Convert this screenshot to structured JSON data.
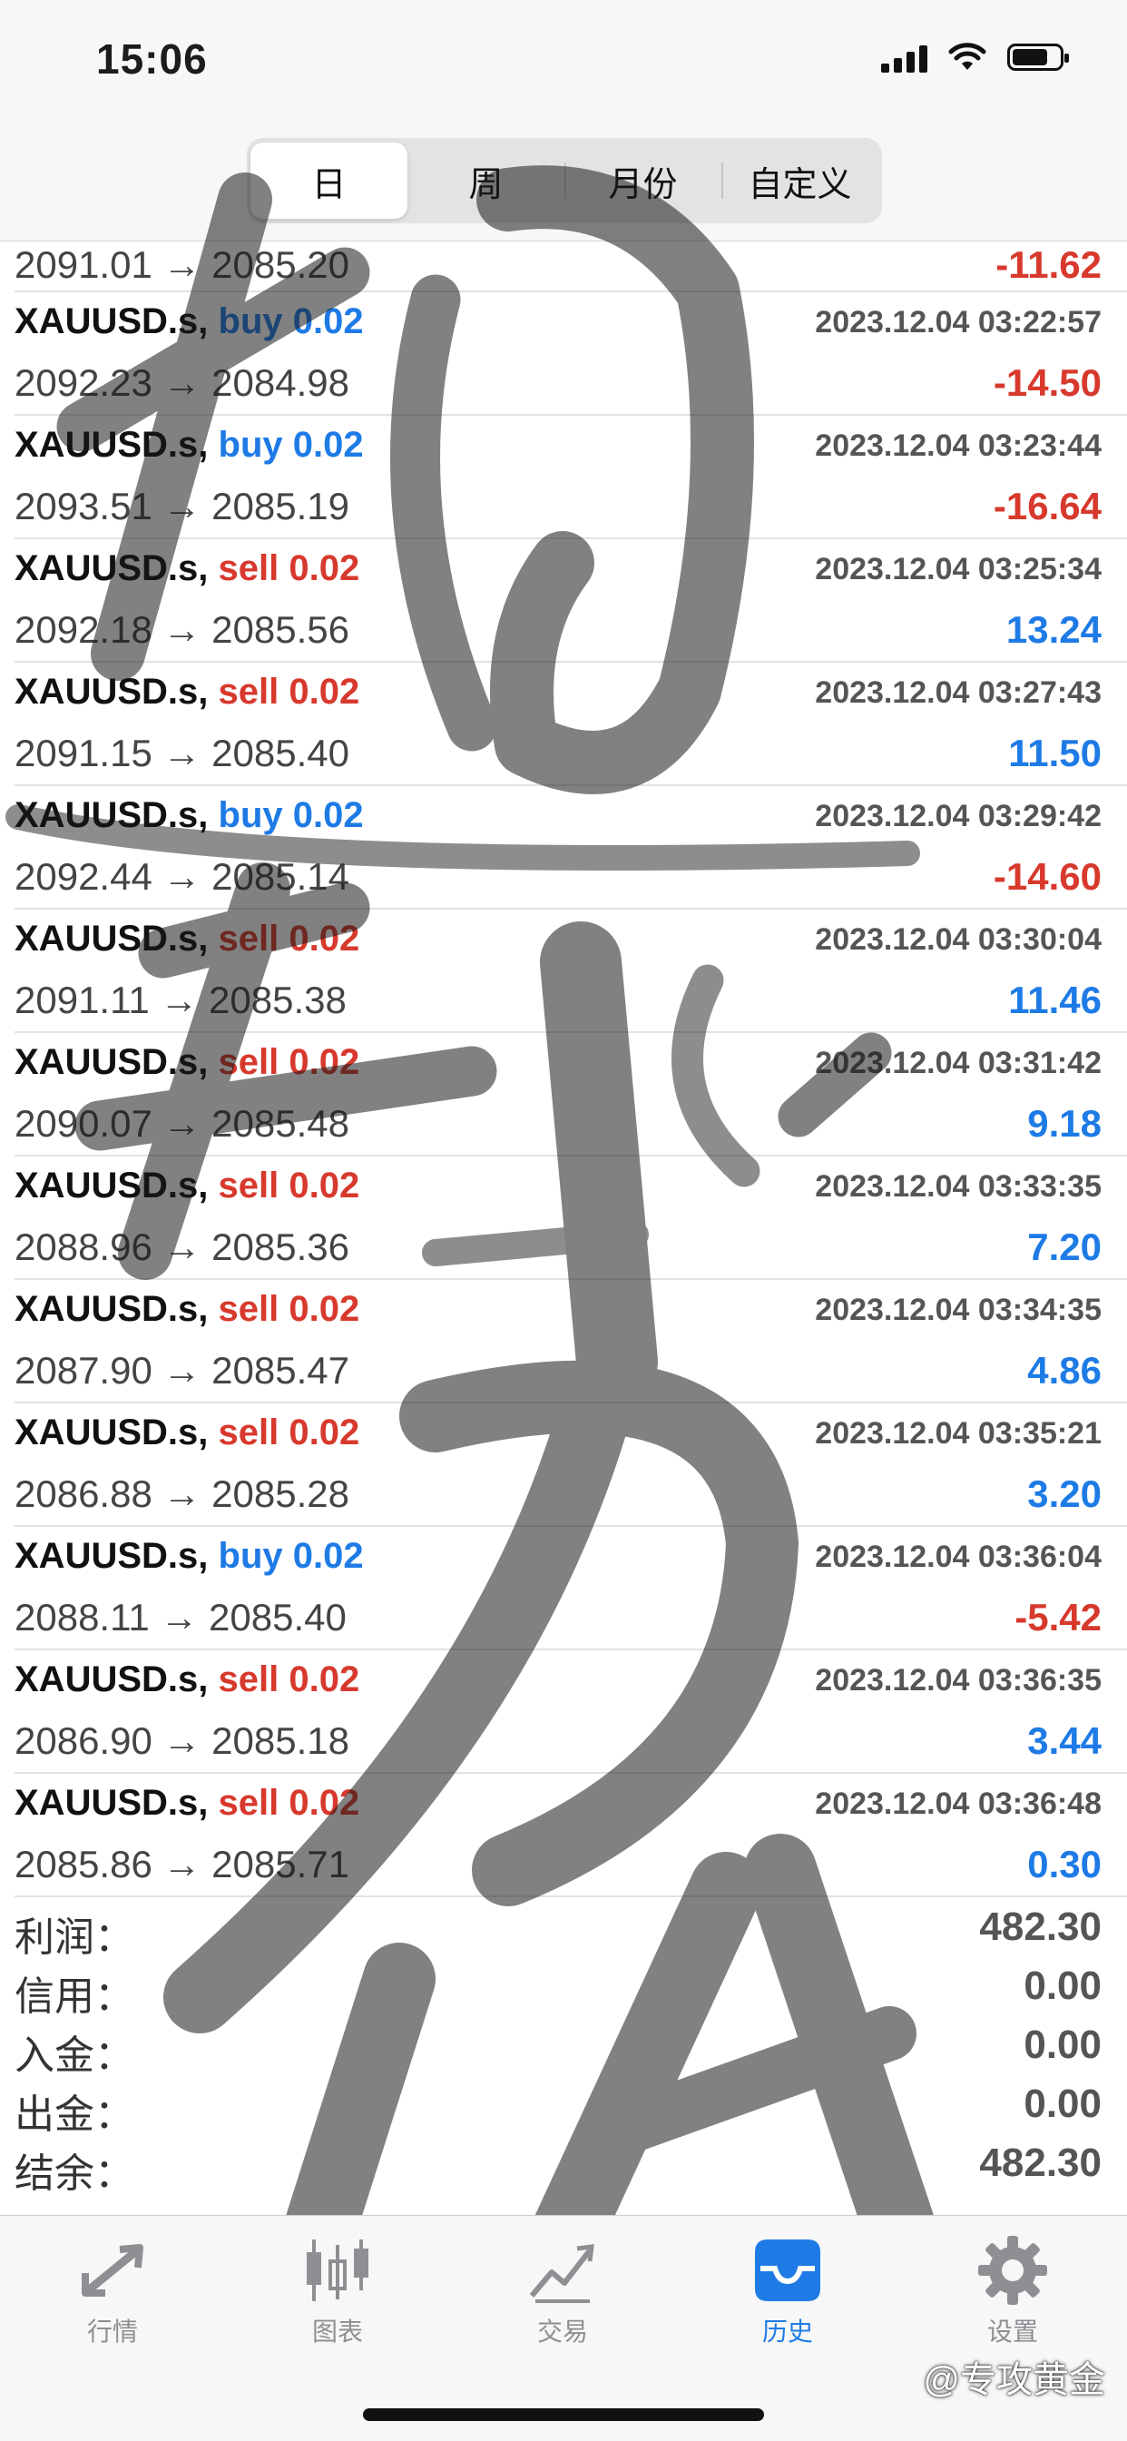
{
  "status_bar": {
    "time": "15:06"
  },
  "period_tabs": [
    {
      "label": "日",
      "active": true
    },
    {
      "label": "周",
      "active": false
    },
    {
      "label": "月份",
      "active": false
    },
    {
      "label": "自定义",
      "active": false
    }
  ],
  "first_row": {
    "prices": "2091.01 → 2085.20",
    "profit": "-11.62"
  },
  "trades": [
    {
      "symbol": "XAUUSD.s,",
      "side": "buy 0.02",
      "time": "2023.12.04 03:22:57",
      "prices": "2092.23 → 2084.98",
      "profit": "-14.50"
    },
    {
      "symbol": "XAUUSD.s,",
      "side": "buy 0.02",
      "time": "2023.12.04 03:23:44",
      "prices": "2093.51 → 2085.19",
      "profit": "-16.64"
    },
    {
      "symbol": "XAUUSD.s,",
      "side": "sell 0.02",
      "time": "2023.12.04 03:25:34",
      "prices": "2092.18 → 2085.56",
      "profit": "13.24"
    },
    {
      "symbol": "XAUUSD.s,",
      "side": "sell 0.02",
      "time": "2023.12.04 03:27:43",
      "prices": "2091.15 → 2085.40",
      "profit": "11.50"
    },
    {
      "symbol": "XAUUSD.s,",
      "side": "buy 0.02",
      "time": "2023.12.04 03:29:42",
      "prices": "2092.44 → 2085.14",
      "profit": "-14.60"
    },
    {
      "symbol": "XAUUSD.s,",
      "side": "sell 0.02",
      "time": "2023.12.04 03:30:04",
      "prices": "2091.11 → 2085.38",
      "profit": "11.46"
    },
    {
      "symbol": "XAUUSD.s,",
      "side": "sell 0.02",
      "time": "2023.12.04 03:31:42",
      "prices": "2090.07 → 2085.48",
      "profit": "9.18"
    },
    {
      "symbol": "XAUUSD.s,",
      "side": "sell 0.02",
      "time": "2023.12.04 03:33:35",
      "prices": "2088.96 → 2085.36",
      "profit": "7.20"
    },
    {
      "symbol": "XAUUSD.s,",
      "side": "sell 0.02",
      "time": "2023.12.04 03:34:35",
      "prices": "2087.90 → 2085.47",
      "profit": "4.86"
    },
    {
      "symbol": "XAUUSD.s,",
      "side": "sell 0.02",
      "time": "2023.12.04 03:35:21",
      "prices": "2086.88 → 2085.28",
      "profit": "3.20"
    },
    {
      "symbol": "XAUUSD.s,",
      "side": "buy 0.02",
      "time": "2023.12.04 03:36:04",
      "prices": "2088.11 → 2085.40",
      "profit": "-5.42"
    },
    {
      "symbol": "XAUUSD.s,",
      "side": "sell 0.02",
      "time": "2023.12.04 03:36:35",
      "prices": "2086.90 → 2085.18",
      "profit": "3.44"
    },
    {
      "symbol": "XAUUSD.s,",
      "side": "sell 0.02",
      "time": "2023.12.04 03:36:48",
      "prices": "2085.86 → 2085.71",
      "profit": "0.30"
    }
  ],
  "summary": [
    {
      "label": "利润：",
      "value": "482.30"
    },
    {
      "label": "信用：",
      "value": "0.00"
    },
    {
      "label": "入金：",
      "value": "0.00"
    },
    {
      "label": "出金：",
      "value": "0.00"
    },
    {
      "label": "结余：",
      "value": "482.30"
    }
  ],
  "tab_bar": [
    {
      "label": "行情",
      "icon": "quotes-arrows-icon",
      "active": false
    },
    {
      "label": "图表",
      "icon": "candlestick-chart-icon",
      "active": false
    },
    {
      "label": "交易",
      "icon": "trade-chart-icon",
      "active": false
    },
    {
      "label": "历史",
      "icon": "history-tray-icon",
      "active": true
    },
    {
      "label": "设置",
      "icon": "gear-icon",
      "active": false
    }
  ],
  "watermark": "@专攻黄金",
  "overlay_calligraphy": "趋势",
  "colors": {
    "buy": "#1e7be6",
    "sell": "#d7392c",
    "profit_positive": "#1e7be6",
    "profit_negative": "#d7392c",
    "tab_active": "#1e7be6"
  }
}
